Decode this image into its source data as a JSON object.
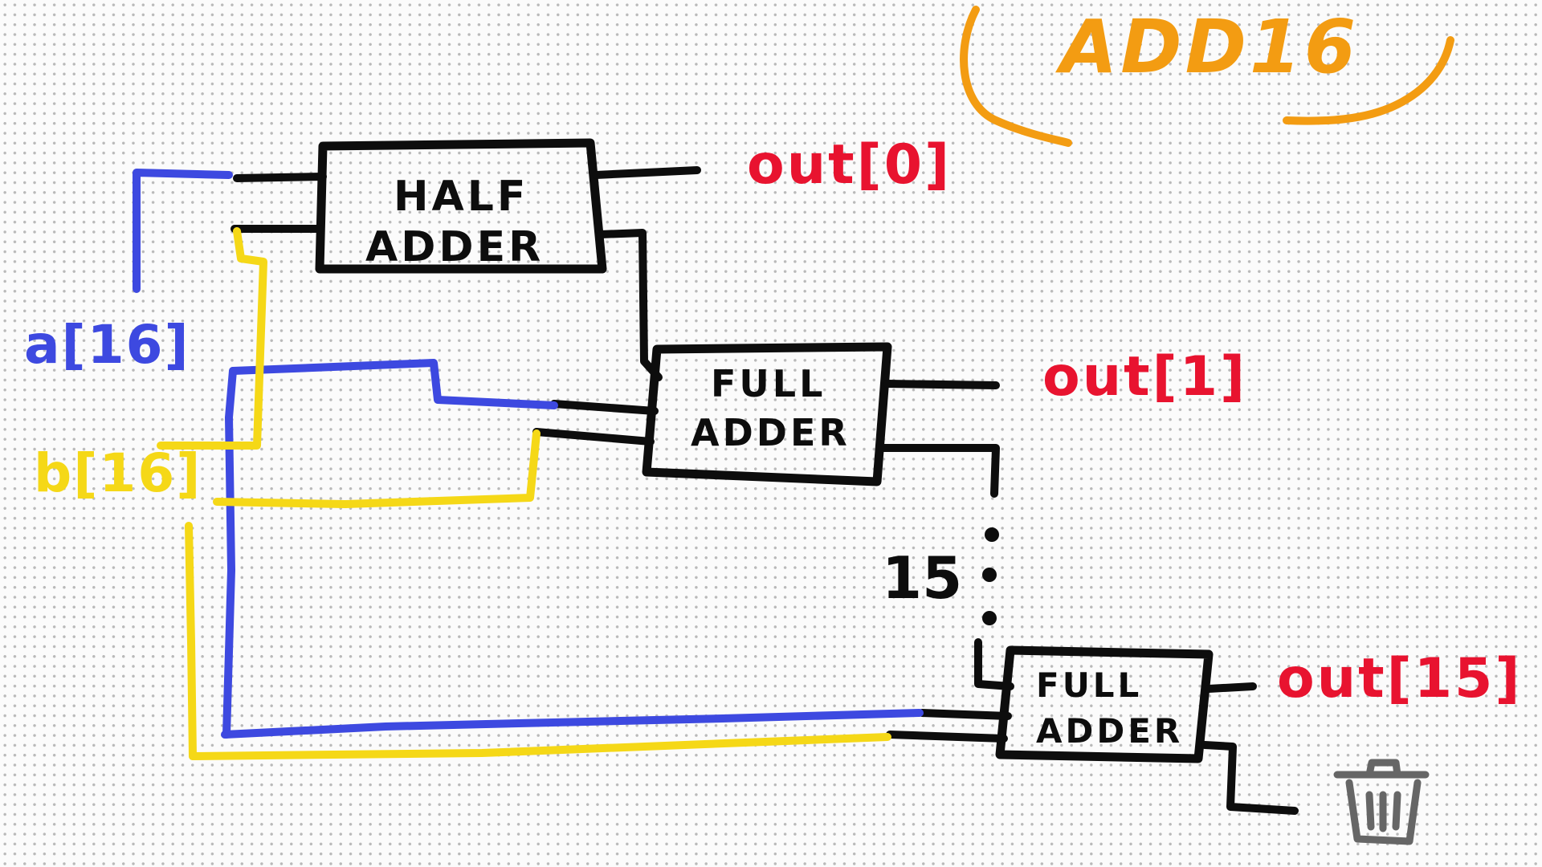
{
  "title": "ADD16",
  "inputs": {
    "a": "a[16]",
    "b": "b[16]"
  },
  "blocks": {
    "half_adder": [
      "HALF",
      "ADDER"
    ],
    "full_adder_1": [
      "FULL",
      "ADDER"
    ],
    "full_adder_15": [
      "FULL",
      "ADDER"
    ]
  },
  "outputs": {
    "out0": "out[0]",
    "out1": "out[1]",
    "out15": "out[15]"
  },
  "repeat_label": "15",
  "icons": {
    "discard": "trash-icon"
  },
  "colors": {
    "title": "#f39c12",
    "a_wire": "#3d49e0",
    "b_wire": "#f5d817",
    "outputs": "#e8132f",
    "wires": "#0d0d0d",
    "trash": "#666666"
  }
}
